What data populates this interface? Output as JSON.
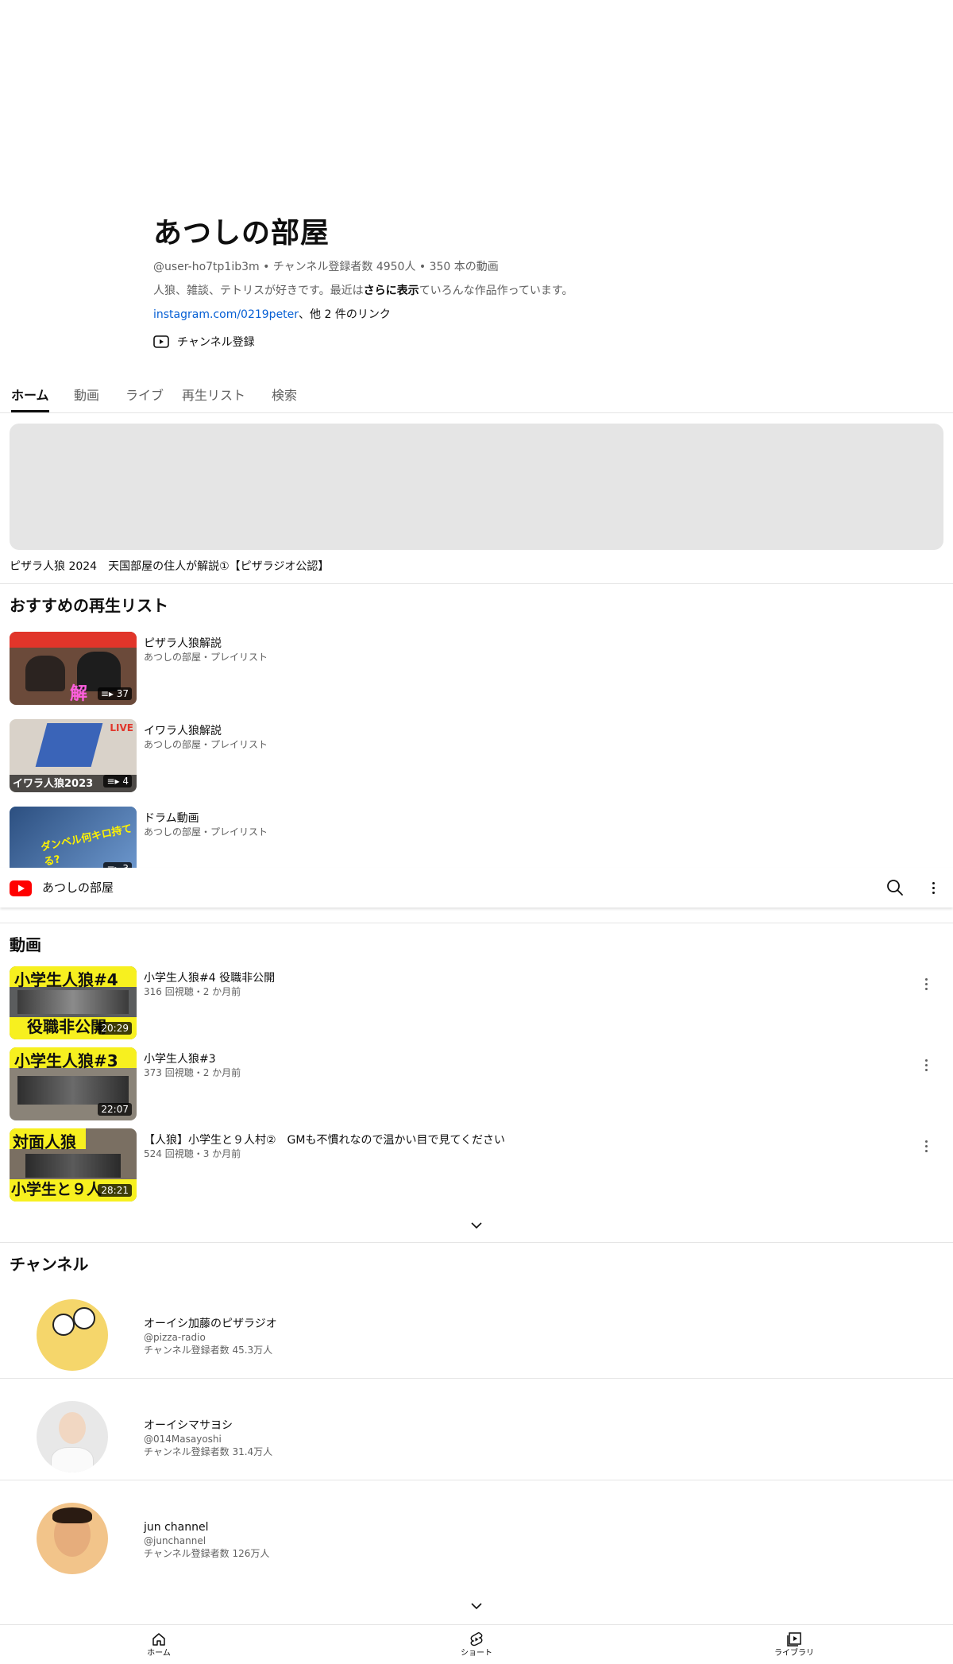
{
  "channel": {
    "name": "あつしの部屋",
    "meta": "@user-ho7tp1ib3m • チャンネル登録者数 4950人 • 350 本の動画",
    "description_prefix": "人狼、雑談、テトリスが好きです。最近は",
    "description_more": "さらに表示",
    "description_suffix": "ていろんな作品作っています。",
    "link_text": "instagram.com/0219peter",
    "link_more": "、他 2 件のリンク",
    "subscribe_label": "チャンネル登録"
  },
  "tabs": [
    {
      "label": "ホーム",
      "active": true
    },
    {
      "label": "動画"
    },
    {
      "label": "ライブ"
    },
    {
      "label": "再生リスト"
    },
    {
      "label": "検索"
    }
  ],
  "featured": {
    "title": "ピザラ人狼 2024　天国部屋の住人が解説①【ピザラジオ公認】"
  },
  "playlists_section": {
    "title": "おすすめの再生リスト",
    "items": [
      {
        "title": "ピザラ人狼解説",
        "sub": "あつしの部屋・プレイリスト",
        "count": "37",
        "thumb_caption": "解",
        "thumb_color": "#6b4a3a"
      },
      {
        "title": "イワラ人狼解説",
        "sub": "あつしの部屋・プレイリスト",
        "count": "4",
        "thumb_caption": "イワラ人狼2023",
        "thumb_badge": "LIVE",
        "thumb_color": "#d9d2c9"
      },
      {
        "title": "ドラム動画",
        "sub": "あつしの部屋・プレイリスト",
        "count": "3",
        "thumb_caption": "ダンベル何キロ持てる?",
        "thumb_color": "#3b6aa8"
      }
    ]
  },
  "topbar": {
    "title": "あつしの部屋"
  },
  "videos_section": {
    "title": "動画",
    "items": [
      {
        "title": "小学生人狼#4 役職非公開",
        "sub": "316 回視聴・2 か月前",
        "duration": "20:29",
        "caption_top": "小学生人狼#4",
        "caption_bottom": "役職非公開"
      },
      {
        "title": "小学生人狼#3",
        "sub": "373 回視聴・2 か月前",
        "duration": "22:07",
        "caption_top": "小学生人狼#3",
        "caption_bottom": ""
      },
      {
        "title": "【人狼】小学生と９人村②　GMも不慣れなので温かい目で見てください",
        "sub": "524 回視聴・3 か月前",
        "duration": "28:21",
        "caption_top": "対面人狼",
        "caption_bottom": "小学生と９人"
      }
    ]
  },
  "channels_section": {
    "title": "チャンネル",
    "items": [
      {
        "name": "オーイシ加藤のピザラジオ",
        "handle": "@pizza-radio",
        "subs": "チャンネル登録者数 45.3万人",
        "avatar_color": "#f5d66b"
      },
      {
        "name": "オーイシマサヨシ",
        "handle": "@014Masayoshi",
        "subs": "チャンネル登録者数 31.4万人",
        "avatar_color": "#e8e8e8"
      },
      {
        "name": "jun channel",
        "handle": "@junchannel",
        "subs": "チャンネル登録者数 126万人",
        "avatar_color": "#f2c48a"
      }
    ]
  },
  "bottom_nav": [
    {
      "label": "ホーム",
      "icon": "home-icon"
    },
    {
      "label": "ショート",
      "icon": "shorts-icon"
    },
    {
      "label": "ライブラリ",
      "icon": "library-icon"
    }
  ],
  "colors": {
    "brand_red": "#ff0000",
    "link_blue": "#065fd4",
    "thumb_yellow": "#f7f01f"
  }
}
